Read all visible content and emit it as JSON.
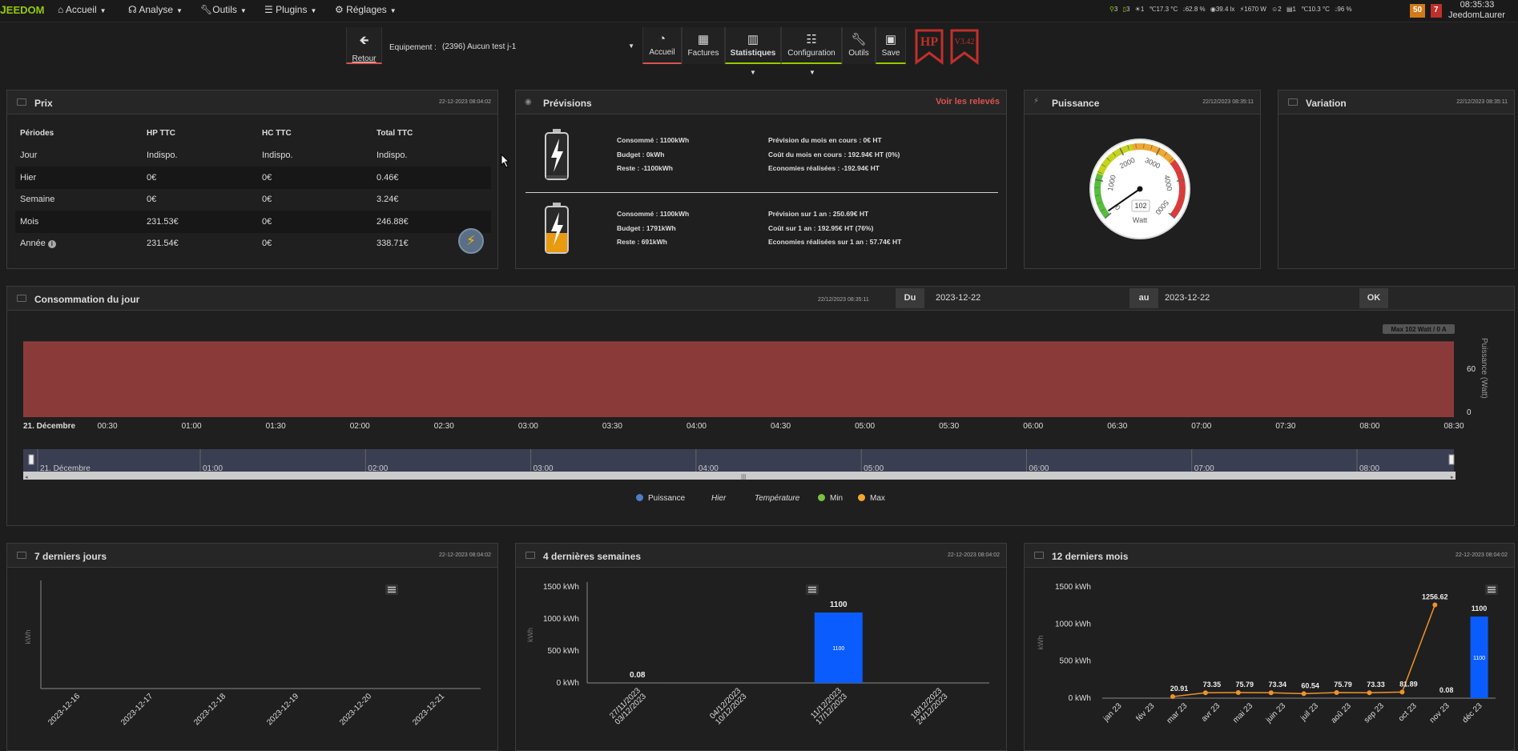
{
  "topbar": {
    "logo": "EEDOM",
    "nav": [
      "Accueil",
      "Analyse",
      "Outils",
      "Plugins",
      "Réglages"
    ],
    "status": [
      "3",
      "3",
      "1",
      "17.3 °C",
      "62.8 %",
      "39.4 lx",
      "1670 W",
      "2",
      "1",
      "10.3 °C",
      "96 %"
    ],
    "badge_orange": "50",
    "badge_red": "7",
    "clock": "08:35:33",
    "user": "JeedomLaurer"
  },
  "toolbar": {
    "retour": "Retour",
    "equipement_label": "Equipement :",
    "equipement_value": "(2396) Aucun test j-1",
    "accueil": "Accueil",
    "factures": "Factures",
    "statistiques": "Statistiques",
    "configuration": "Configuration",
    "outils": "Outils",
    "save": "Save",
    "hp": "HP",
    "version": "V3.42"
  },
  "prix": {
    "title": "Prix",
    "date": "22-12-2023 08:04:02",
    "headers": [
      "Périodes",
      "HP TTC",
      "HC TTC",
      "Total TTC"
    ],
    "rows": [
      [
        "Jour",
        "Indispo.",
        "Indispo.",
        "Indispo."
      ],
      [
        "Hier",
        "0€",
        "0€",
        "0.46€"
      ],
      [
        "Semaine",
        "0€",
        "0€",
        "3.24€"
      ],
      [
        "Mois",
        "231.53€",
        "0€",
        "246.88€"
      ],
      [
        "Année",
        "231.54€",
        "0€",
        "338.71€"
      ]
    ]
  },
  "previsions": {
    "title": "Prévisions",
    "link": "Voir les relevés",
    "block1_left": [
      "Consommé : 1100kWh",
      "Budget : 0kWh",
      "Reste : -1100kWh"
    ],
    "block1_right": [
      "Prévision du mois en cours : 0€ HT",
      "Coût du mois en cours : 192.94€ HT (0%)",
      "Economies réalisées : -192.94€ HT"
    ],
    "block2_left": [
      "Consommé : 1100kWh",
      "Budget : 1791kWh",
      "Reste : 691kWh"
    ],
    "block2_right": [
      "Prévision sur 1 an : 250.69€ HT",
      "Coût sur 1 an : 192.95€ HT (76%)",
      "Economies réalisées sur 1 an : 57.74€ HT"
    ]
  },
  "puissance": {
    "title": "Puissance",
    "date": "22/12/2023 08:35:11",
    "gauge_value": 102,
    "gauge_unit": "Watt",
    "gauge_ticks": [
      "0",
      "1000",
      "2000",
      "3000",
      "4000",
      "5000"
    ]
  },
  "variation": {
    "title": "Variation",
    "date": "22/12/2023 08:35:11"
  },
  "conso": {
    "title": "Consommation du jour",
    "date": "22/12/2023 08:35:11",
    "du_label": "Du",
    "du_value": "2023-12-22",
    "au_label": "au",
    "au_value": "2023-12-22",
    "ok": "OK",
    "tooltip": "Max 102 Watt / 0 A",
    "yaxis_label": "Puissance (Watt)",
    "yticks": [
      "60",
      "0"
    ],
    "xticks": [
      "21. Décembre",
      "00:30",
      "01:00",
      "01:30",
      "02:00",
      "02:30",
      "03:00",
      "03:30",
      "04:00",
      "04:30",
      "05:00",
      "05:30",
      "06:00",
      "06:30",
      "07:00",
      "07:30",
      "08:00",
      "08:30"
    ],
    "nav_ticks": [
      "21. Décembre",
      "01:00",
      "02:00",
      "03:00",
      "04:00",
      "05:00",
      "06:00",
      "07:00",
      "08:00"
    ],
    "legend": [
      "Puissance",
      "Hier",
      "Température",
      "Min",
      "Max"
    ]
  },
  "week7": {
    "title": "7 derniers jours",
    "date": "22-12-2023 08:04:02",
    "ylabel": "kWh"
  },
  "week4": {
    "title": "4 dernières semaines",
    "date": "22-12-2023 08:04:02",
    "ylabel": "kWh",
    "yticks": [
      "1500 kWh",
      "1000 kWh",
      "500 kWh",
      "0 kWh"
    ],
    "inner_label": "1100"
  },
  "month12": {
    "title": "12 derniers mois",
    "date": "22-12-2023 08:04:02",
    "ylabel": "kWh",
    "yticks": [
      "1500 kWh",
      "1000 kWh",
      "500 kWh",
      "0 kWh"
    ],
    "inner_label": "1100"
  },
  "chart_data": [
    {
      "type": "area",
      "title": "Consommation du jour",
      "ylabel": "Puissance (Watt)",
      "x": [
        "21. Décembre",
        "08:30"
      ],
      "series": [
        {
          "name": "Puissance",
          "values": [
            102,
            102
          ]
        }
      ],
      "color": "#8b3a3a"
    },
    {
      "type": "bar",
      "title": "7 derniers jours",
      "ylabel": "kWh",
      "categories": [
        "2023-12-16",
        "2023-12-17",
        "2023-12-18",
        "2023-12-19",
        "2023-12-20",
        "2023-12-21"
      ],
      "values": [
        null,
        null,
        null,
        null,
        null,
        null
      ]
    },
    {
      "type": "bar",
      "title": "4 dernières semaines",
      "ylabel": "kWh",
      "ylim": [
        0,
        1500
      ],
      "categories": [
        "27/11/2023\n03/12/2023",
        "04/12/2023\n10/12/2023",
        "11/12/2023\n17/12/2023",
        "18/12/2023\n24/12/2023"
      ],
      "values": [
        0.08,
        null,
        1100,
        null
      ],
      "color": "#0b5cff"
    },
    {
      "type": "bar",
      "title": "12 derniers mois",
      "ylabel": "kWh",
      "ylim": [
        0,
        1500
      ],
      "categories": [
        "jan 23",
        "fév 23",
        "mar 23",
        "avr 23",
        "mai 23",
        "juin 23",
        "juil 23",
        "aoû 23",
        "sep 23",
        "oct 23",
        "nov 23",
        "déc 23"
      ],
      "series": [
        {
          "name": "bar",
          "values": [
            null,
            null,
            null,
            null,
            null,
            null,
            null,
            null,
            null,
            null,
            0.08,
            1100
          ]
        },
        {
          "name": "line",
          "values": [
            null,
            null,
            20.91,
            73.35,
            75.79,
            73.34,
            60.54,
            75.79,
            73.33,
            81.89,
            1256.62,
            null
          ]
        }
      ],
      "bar_color": "#0b5cff",
      "line_color": "#f0922b"
    }
  ]
}
